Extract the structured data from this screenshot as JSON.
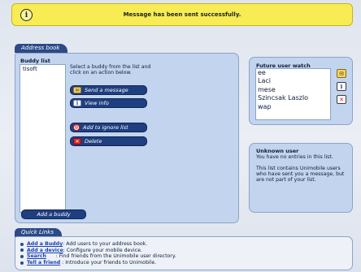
{
  "message": {
    "text": "Message has been sent successfully."
  },
  "address_book": {
    "tab_label": "Address book",
    "buddy_list": {
      "title": "Buddy list",
      "items": [
        "tisoft"
      ],
      "instructions": "Select a buddy from the list and click on an action below.",
      "actions": {
        "send_message": "Send a message",
        "view_info": "View info",
        "ignore": "Add to ignore list",
        "delete": "Delete"
      },
      "add_buddy": "Add a buddy"
    }
  },
  "future_user_watch": {
    "title": "Future user watch",
    "items": [
      "ee",
      "Laci",
      "mese",
      "Szincsak Laszlo",
      "wap"
    ]
  },
  "unknown_user": {
    "title": "Unknown user",
    "empty_text": "You have no entries in this list.",
    "description": "This list contains Unimobile users who have sent you a message, but are not part of your list."
  },
  "quick_links": {
    "tab_label": "Quick Links",
    "items": [
      {
        "link": "Add a Buddy",
        "desc": ": Add users to your address book."
      },
      {
        "link": "Add a device",
        "desc": ": Configure your mobile device."
      },
      {
        "link": "Search",
        "desc": "      : Find friends from the Unimobile user directory."
      },
      {
        "link": "Tell a friend",
        "desc": " : Introduce your friends to Unimobile."
      }
    ]
  },
  "colors": {
    "message_bg": "#f7ec54",
    "panel_bg": "#c3d4ee",
    "button_bg": "#1f3f80",
    "delete_red": "#d9262a"
  }
}
